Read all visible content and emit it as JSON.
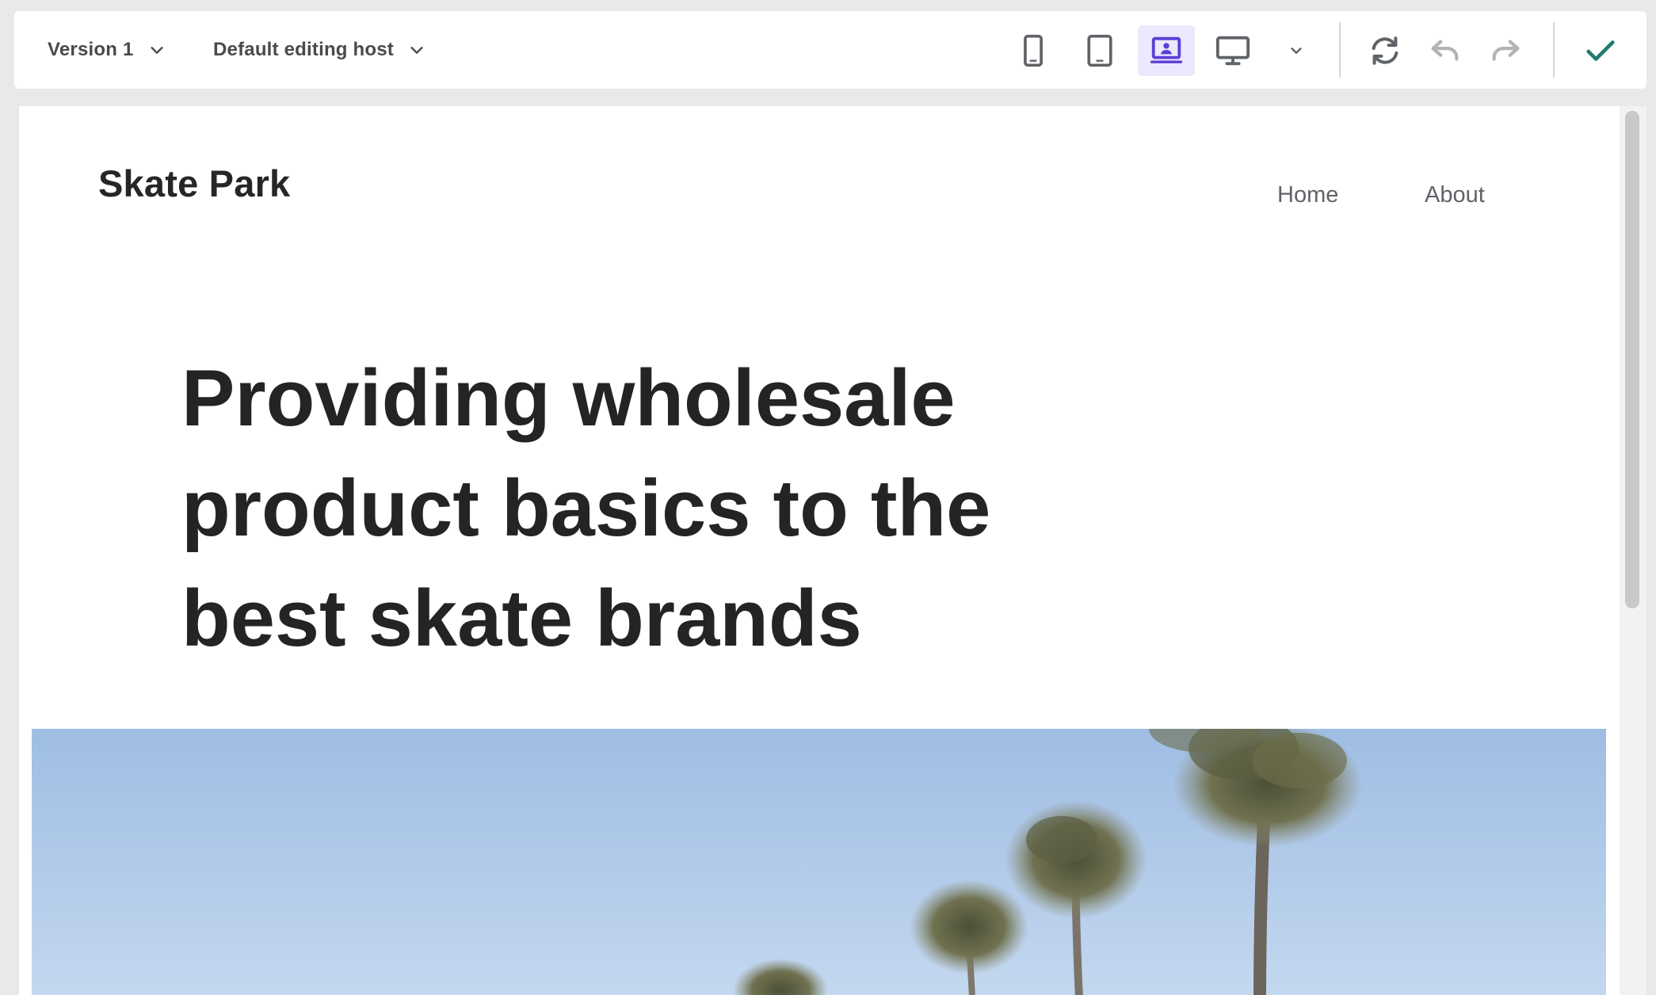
{
  "toolbar": {
    "version_label": "Version 1",
    "host_label": "Default editing host",
    "devices": [
      {
        "icon": "phone-icon",
        "active": false
      },
      {
        "icon": "tablet-icon",
        "active": false
      },
      {
        "icon": "laptop-icon",
        "active": true
      },
      {
        "icon": "desktop-icon",
        "active": false
      }
    ],
    "accent_color": "#5b3fd6",
    "confirm_color": "#1f7a6e"
  },
  "site": {
    "logo": "Skate Park",
    "nav": [
      "Home",
      "About"
    ],
    "hero_title": "Providing wholesale product basics to the best skate brands",
    "hero_image": "palm-trees-photo"
  }
}
